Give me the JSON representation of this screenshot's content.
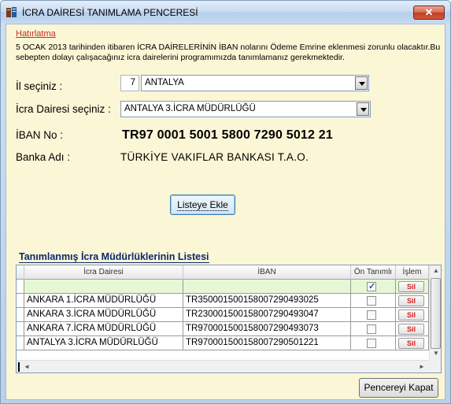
{
  "window": {
    "title": "İCRA DAİRESİ TANIMLAMA PENCERESİ",
    "close_label": "✕"
  },
  "reminder": {
    "label": "Hatırlatma",
    "text": "5 OCAK 2013 tarihinden itibaren İCRA DAİRELERİNİN İBAN nolarını Ödeme Emrine eklenmesi zorunlu olacaktır.Bu sebepten dolayı çalışacağınız icra dairelerini programımızda tanımlamanız gerekmektedir."
  },
  "form": {
    "city_label": "İl seçiniz :",
    "city_code": "7",
    "city_value": "ANTALYA",
    "office_label": "İcra Dairesi seçiniz :",
    "office_value": "ANTALYA 3.İCRA MÜDÜRLÜĞÜ",
    "iban_label": "İBAN No :",
    "iban_value": "TR97 0001 5001 5800 7290 5012 21",
    "bank_label": "Banka Adı :",
    "bank_value": "TÜRKİYE VAKIFLAR BANKASI T.A.O."
  },
  "buttons": {
    "add_to_list": "Listeye Ekle",
    "close_window": "Pencereyi Kapat"
  },
  "list": {
    "title": "Tanımlanmış İcra Müdürlüklerinin Listesi",
    "columns": [
      "İcra Dairesi",
      "İBAN",
      "Ön Tanımlı",
      "İşlem"
    ],
    "delete_label": "Sil",
    "new_row_default_checked": true,
    "rows": [
      {
        "office": "ANKARA 1.İCRA MÜDÜRLÜĞÜ",
        "iban": "TR350001500158007290493025",
        "default": false
      },
      {
        "office": "ANKARA 3.İCRA MÜDÜRLÜĞÜ",
        "iban": "TR230001500158007290493047",
        "default": false
      },
      {
        "office": "ANKARA 7.İCRA MÜDÜRLÜĞÜ",
        "iban": "TR970001500158007290493073",
        "default": false
      },
      {
        "office": "ANTALYA 3.İCRA MÜDÜRLÜĞÜ",
        "iban": "TR970001500158007290501221",
        "default": false
      }
    ]
  },
  "colors": {
    "panel_background": "#fbf6d6",
    "reminder_red": "#c62a20",
    "list_title_blue": "#0a2a6a",
    "new_row_green": "#e6f7d5"
  }
}
